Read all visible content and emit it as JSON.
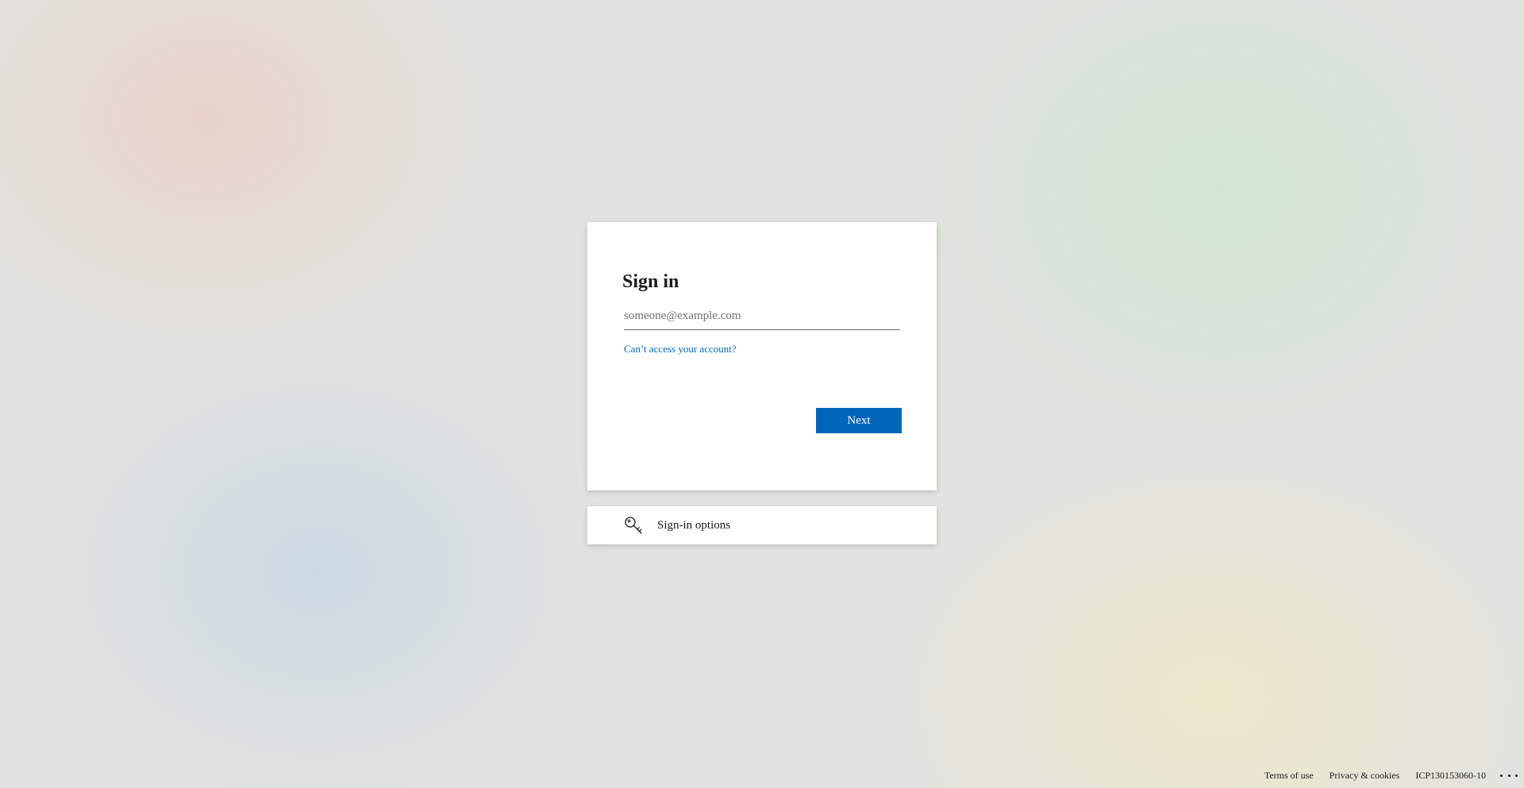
{
  "signin": {
    "title": "Sign in",
    "email_placeholder": "someone@example.com",
    "email_value": "",
    "access_link": "Can’t access your account?",
    "next_label": "Next"
  },
  "options": {
    "label": "Sign-in options",
    "icon": "key-icon"
  },
  "footer": {
    "terms": "Terms of use",
    "privacy": "Privacy & cookies",
    "icp": "ICP130153060-10",
    "more_icon": "ellipsis-icon"
  },
  "colors": {
    "accent": "#0067b8",
    "text": "#1b1b1b",
    "card": "#ffffff"
  }
}
